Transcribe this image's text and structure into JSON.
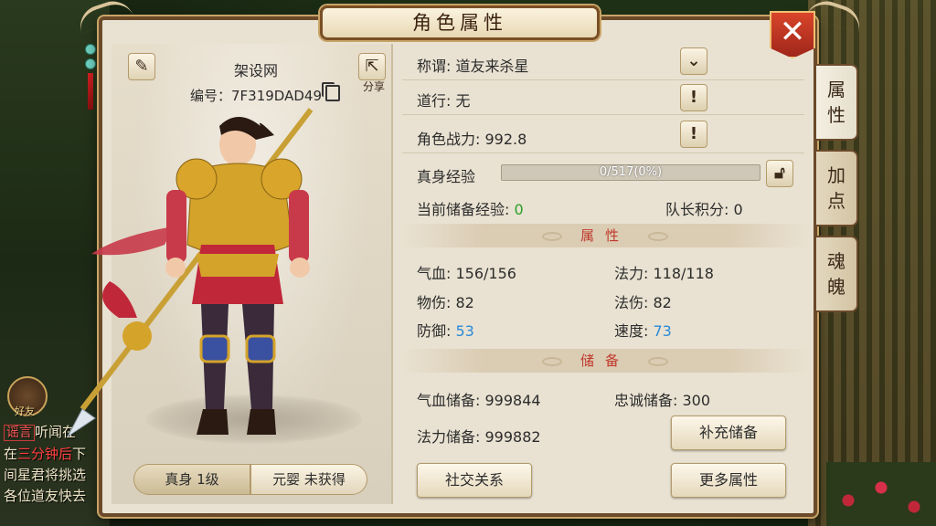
{
  "window": {
    "title": "角色属性",
    "close_label": "✕"
  },
  "character": {
    "name": "架设网",
    "id_label": "编号：",
    "id_value": "7F319DAD49",
    "share_label": "分享",
    "form_tabs": [
      {
        "label": "真身 1级",
        "active": true
      },
      {
        "label": "元婴 未获得",
        "active": false
      }
    ]
  },
  "info": {
    "title_label": "称谓:",
    "title_value": "道友来杀星",
    "daoxing_label": "道行:",
    "daoxing_value": "无",
    "power_label": "角色战力:",
    "power_value": "992.8",
    "exp_label": "真身经验",
    "exp_text": "0/517(0%)",
    "exp_progress": 0,
    "stored_exp_label": "当前储备经验:",
    "stored_exp_value": "0",
    "captain_label": "队长积分:",
    "captain_value": "0"
  },
  "attributes": {
    "header": "属性",
    "hp_label": "气血:",
    "hp_value": "156/156",
    "mp_label": "法力:",
    "mp_value": "118/118",
    "phys_label": "物伤:",
    "phys_value": "82",
    "mag_label": "法伤:",
    "mag_value": "82",
    "def_label": "防御:",
    "def_value": "53",
    "spd_label": "速度:",
    "spd_value": "73"
  },
  "reserves": {
    "header": "储备",
    "hp_res_label": "气血储备:",
    "hp_res_value": "999844",
    "loyalty_label": "忠诚储备:",
    "loyalty_value": "300",
    "mp_res_label": "法力储备:",
    "mp_res_value": "999882"
  },
  "buttons": {
    "replenish": "补充储备",
    "social": "社交关系",
    "more": "更多属性"
  },
  "side_tabs": [
    {
      "label": "属\n性",
      "active": true
    },
    {
      "label": "加\n点",
      "active": false
    },
    {
      "label": "魂\n魄",
      "active": false
    }
  ],
  "chat": {
    "tag": "谣言",
    "line1": "听闻在",
    "line2_prefix": "在",
    "line2_red": "三分钟后",
    "line2_suffix": "下",
    "line3": "间星君将挑选",
    "line4": "各位道友快去"
  },
  "friend_label": "好友",
  "colors": {
    "accent_green": "#2aa02a",
    "accent_blue": "#2a8ad8",
    "section_red": "#c0392b",
    "frame_brown": "#6b4a2a"
  }
}
